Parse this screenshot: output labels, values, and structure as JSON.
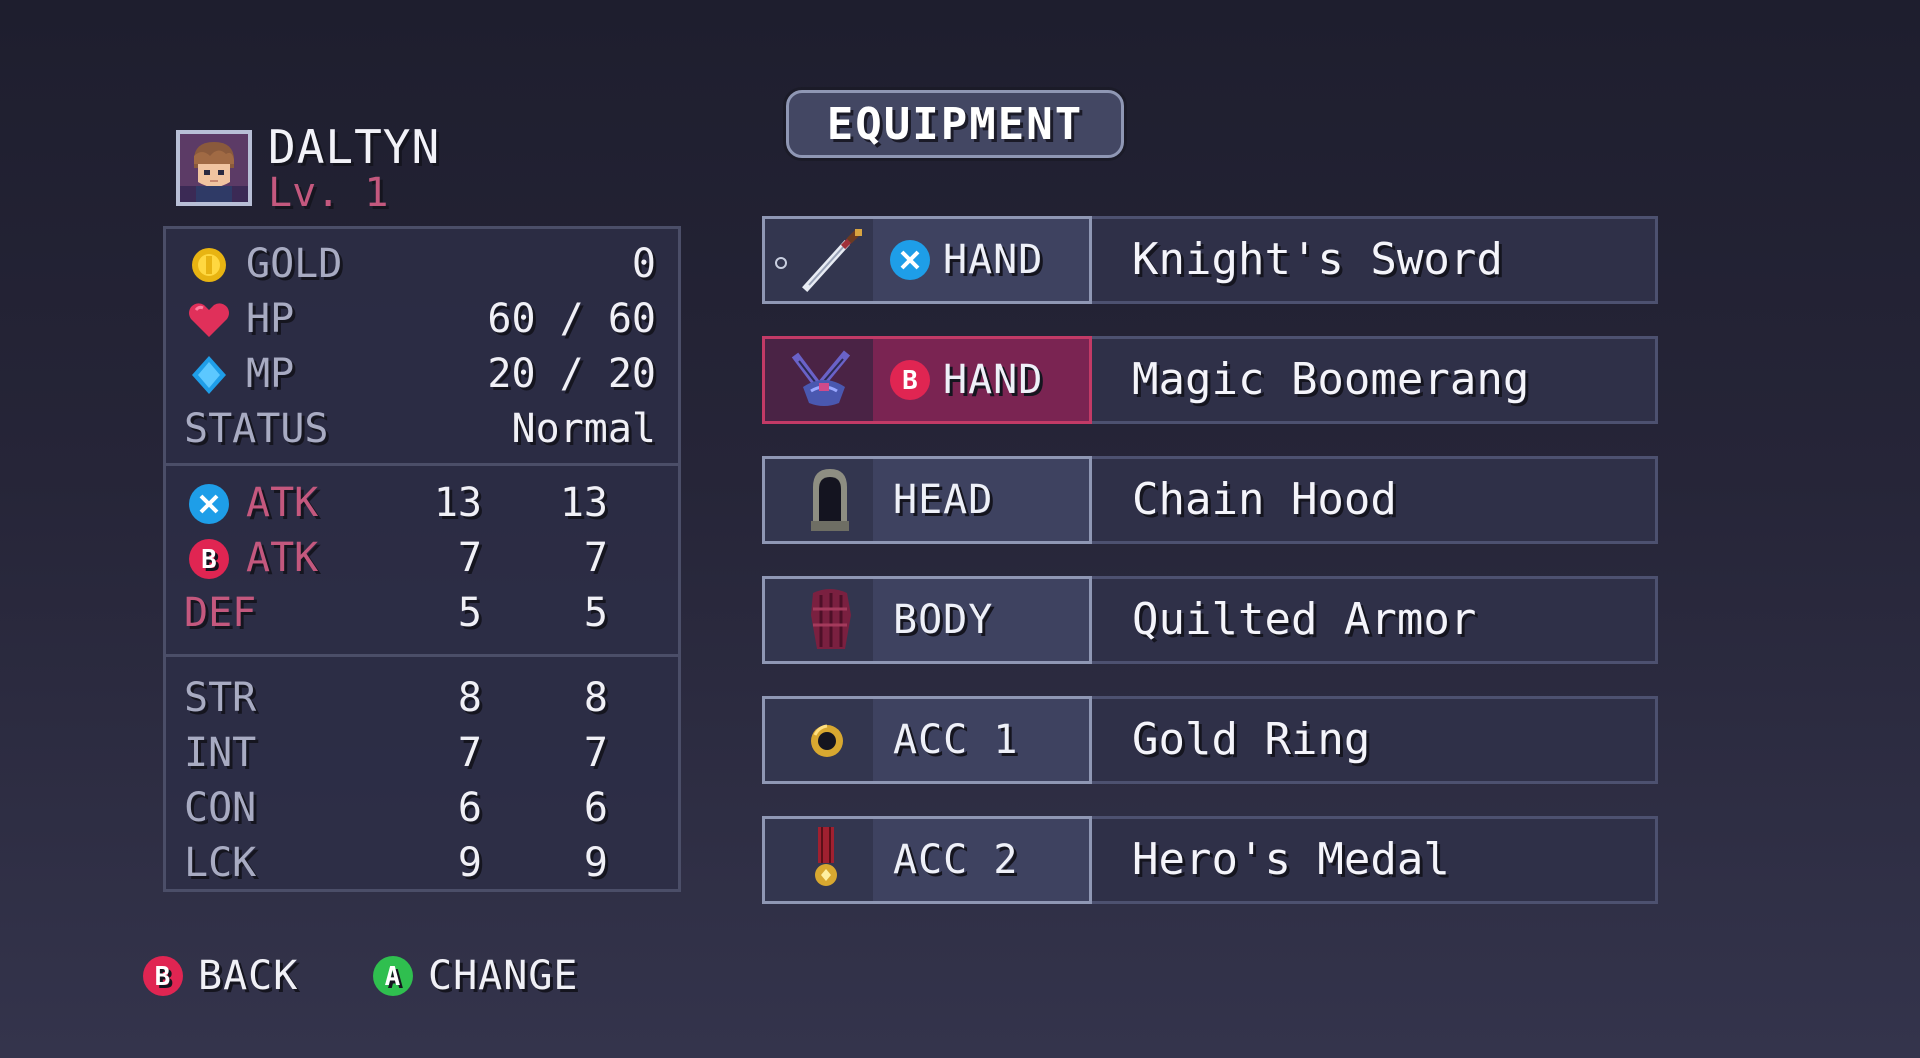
{
  "screen": {
    "title": "EQUIPMENT"
  },
  "character": {
    "name": "DALTYN",
    "level": "Lv. 1"
  },
  "stats": {
    "gold": {
      "label": "GOLD",
      "value": "0"
    },
    "hp": {
      "label": "HP",
      "value": "60 / 60"
    },
    "mp": {
      "label": "MP",
      "value": "20 / 20"
    },
    "status": {
      "label": "STATUS",
      "value": "Normal"
    },
    "x_atk": {
      "label": "ATK",
      "current": "13",
      "new": "13"
    },
    "b_atk": {
      "label": "ATK",
      "current": "7",
      "new": "7"
    },
    "def": {
      "label": "DEF",
      "current": "5",
      "new": "5"
    },
    "str": {
      "label": "STR",
      "current": "8",
      "new": "8"
    },
    "int": {
      "label": "INT",
      "current": "7",
      "new": "7"
    },
    "con": {
      "label": "CON",
      "current": "6",
      "new": "6"
    },
    "lck": {
      "label": "LCK",
      "current": "9",
      "new": "9"
    }
  },
  "slots": [
    {
      "label": "HAND",
      "button": "X",
      "item": "Knight's Sword",
      "icon": "sword-icon",
      "selected": false
    },
    {
      "label": "HAND",
      "button": "B",
      "item": "Magic Boomerang",
      "icon": "boomerang-icon",
      "selected": true
    },
    {
      "label": "HEAD",
      "button": "",
      "item": "Chain Hood",
      "icon": "hood-icon",
      "selected": false
    },
    {
      "label": "BODY",
      "button": "",
      "item": "Quilted Armor",
      "icon": "armor-icon",
      "selected": false
    },
    {
      "label": "ACC 1",
      "button": "",
      "item": "Gold Ring",
      "icon": "ring-icon",
      "selected": false
    },
    {
      "label": "ACC 2",
      "button": "",
      "item": "Hero's Medal",
      "icon": "medal-icon",
      "selected": false
    }
  ],
  "footer": {
    "back": {
      "button": "B",
      "label": "BACK"
    },
    "change": {
      "button": "A",
      "label": "CHANGE"
    }
  },
  "colors": {
    "x_button": "#1e9ee8",
    "b_button": "#e02552",
    "a_button": "#2fbf4f",
    "accent_pink": "#c4587e",
    "selected_slot": "#7a2452"
  }
}
